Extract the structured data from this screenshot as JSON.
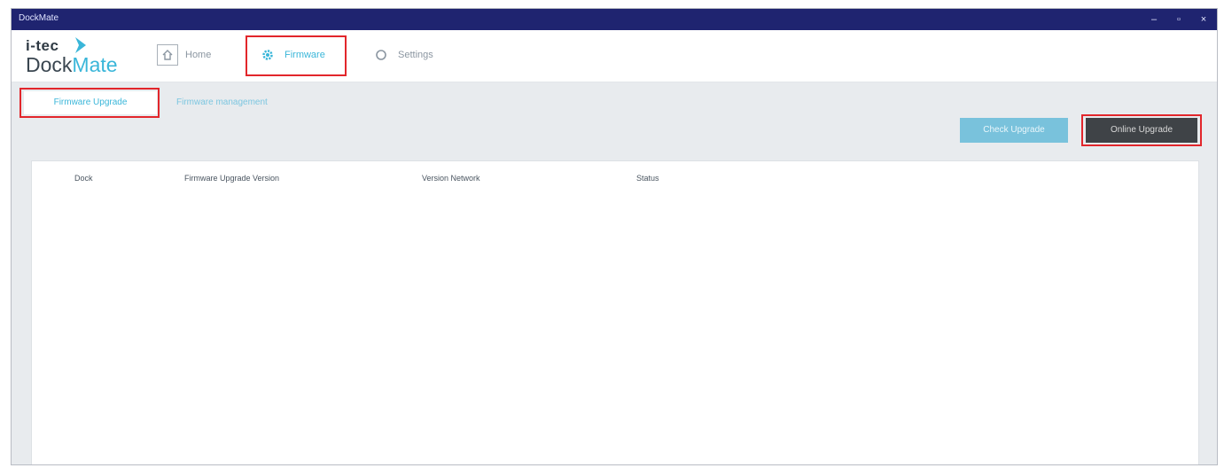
{
  "window": {
    "title": "DockMate",
    "controls": {
      "minimize": "–",
      "maximize": "▫",
      "close": "×"
    }
  },
  "logo": {
    "brand": "i-tec",
    "product_a": "Dock",
    "product_b": "Mate"
  },
  "nav": {
    "items": [
      {
        "label": "Home",
        "icon": "home-icon"
      },
      {
        "label": "Firmware",
        "icon": "gear-icon",
        "active": true
      },
      {
        "label": "Settings",
        "icon": "settings-icon"
      }
    ]
  },
  "subtabs": {
    "selected": "Firmware Upgrade",
    "other": "Firmware management"
  },
  "buttons": {
    "check": "Check Upgrade",
    "online": "Online Upgrade"
  },
  "table": {
    "columns": [
      "Dock",
      "Firmware Upgrade Version",
      "Version Network",
      "Status"
    ]
  },
  "colors": {
    "accent": "#3ab6d9",
    "highlight": "#e2262b",
    "titlebar": "#1f2470"
  }
}
